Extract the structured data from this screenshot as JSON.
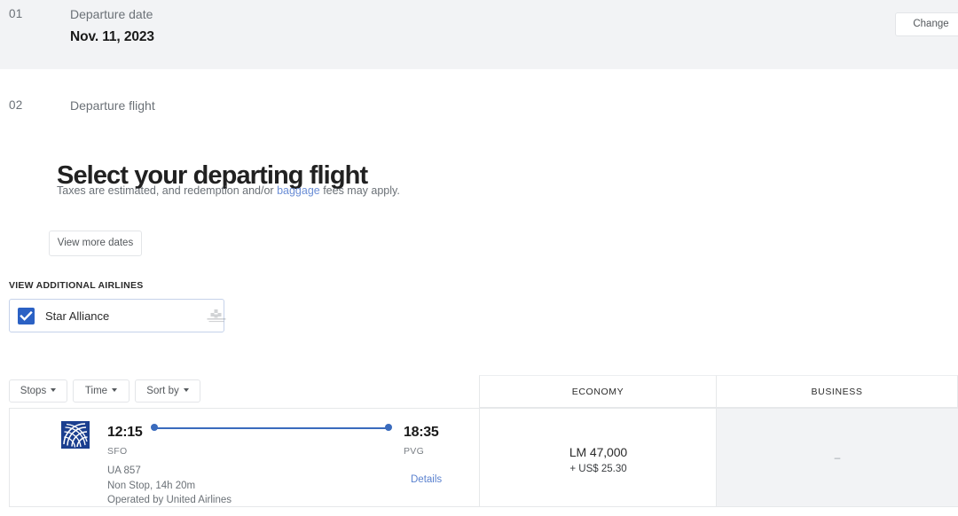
{
  "steps": {
    "departure_date": {
      "number": "01",
      "label": "Departure date",
      "value": "Nov. 11, 2023",
      "change_label": "Change"
    },
    "departure_flight": {
      "number": "02",
      "label": "Departure flight"
    }
  },
  "main": {
    "title": "Select your departing flight",
    "subtitle_before": "Taxes are estimated, and redemption and/or ",
    "subtitle_link": "baggage",
    "subtitle_after": " fees may apply.",
    "view_more_dates_label": "View more dates"
  },
  "airlines": {
    "heading": "VIEW ADDITIONAL AIRLINES",
    "option_label": "Star Alliance",
    "checked": true,
    "logo_icon": "star-alliance-logo-icon"
  },
  "filters": [
    {
      "label": "Stops",
      "icon": "chevron-down-icon"
    },
    {
      "label": "Time",
      "icon": "chevron-down-icon"
    },
    {
      "label": "Sort by",
      "icon": "chevron-down-icon"
    }
  ],
  "columns": {
    "economy": "ECONOMY",
    "business": "BUSINESS"
  },
  "flight": {
    "airline_logo_icon": "united-airlines-globe-icon",
    "depart_time": "12:15",
    "depart_airport": "SFO",
    "arrive_time": "18:35",
    "arrive_airport": "PVG",
    "flight_number": "UA 857",
    "stops_duration": "Non Stop, 14h 20m",
    "operated_by": "Operated by United Airlines",
    "details_label": "Details",
    "economy_price": "LM 47,000",
    "economy_tax": "+ US$ 25.30",
    "business_price": "–"
  },
  "colors": {
    "accent_blue": "#2b61c4",
    "route_blue": "#3a6bbd",
    "link_blue": "#5b82cf",
    "band_grey": "#f2f3f5",
    "border_grey": "#e6e8ea"
  }
}
